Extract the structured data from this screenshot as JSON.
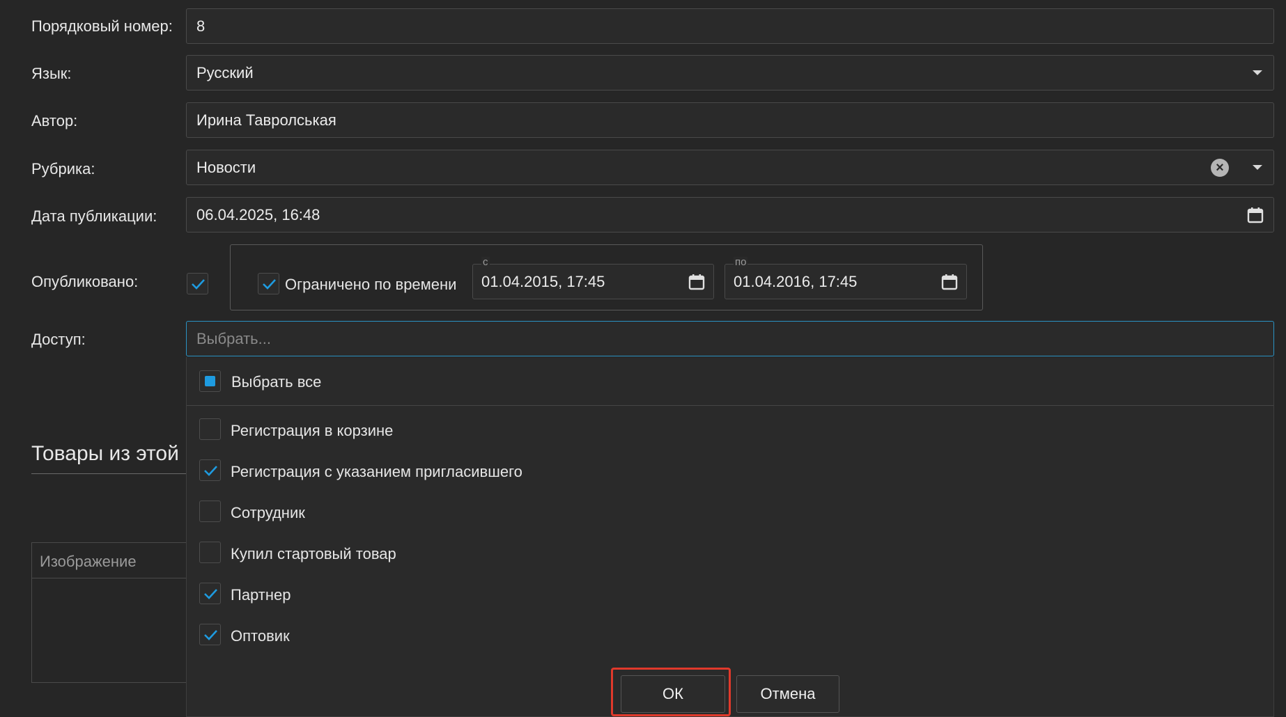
{
  "form": {
    "order_number": {
      "label": "Порядковый номер:",
      "value": "8"
    },
    "language": {
      "label": "Язык:",
      "value": "Русский"
    },
    "author": {
      "label": "Автор:",
      "value": "Ирина Тавролськая"
    },
    "rubric": {
      "label": "Рубрика:",
      "value": "Новости"
    },
    "publish_date": {
      "label": "Дата публикации:",
      "value": "06.04.2025, 16:48"
    },
    "published": {
      "label": "Опубликовано:",
      "checked": true,
      "time_limited_label": "Ограничено по времени",
      "time_limited_checked": true,
      "from_label": "с",
      "from_value": "01.04.2015, 17:45",
      "to_label": "по",
      "to_value": "01.04.2016, 17:45"
    },
    "access": {
      "label": "Доступ:",
      "placeholder": "Выбрать..."
    }
  },
  "section": {
    "products_title": "Товары из этой",
    "image_column": "Изображение"
  },
  "dropdown": {
    "select_all": "Выбрать все",
    "items": [
      {
        "label": "Регистрация в корзине",
        "checked": false
      },
      {
        "label": "Регистрация с указанием пригласившего",
        "checked": true
      },
      {
        "label": "Сотрудник",
        "checked": false
      },
      {
        "label": "Купил стартовый товар",
        "checked": false
      },
      {
        "label": "Партнер",
        "checked": true
      },
      {
        "label": "Оптовик",
        "checked": true
      }
    ],
    "ok_label": "ОК",
    "cancel_label": "Отмена"
  },
  "colors": {
    "background": "#262626",
    "accent": "#1e9be0",
    "highlight": "#e0392b"
  }
}
